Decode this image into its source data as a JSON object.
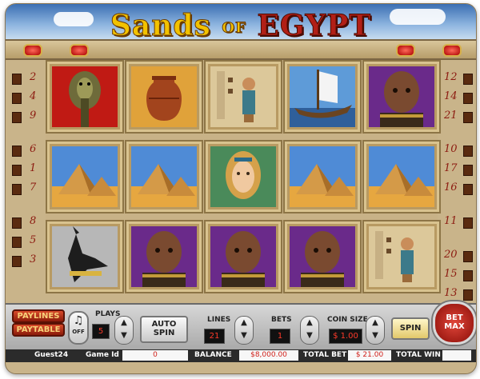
{
  "game": {
    "title_part1": "Sands",
    "title_part2": "OF",
    "title_part3": "EGYPT"
  },
  "paylines": {
    "left": [
      "2",
      "4",
      "9",
      "6",
      "1",
      "7",
      "8",
      "5",
      "3"
    ],
    "right": [
      "12",
      "14",
      "21",
      "10",
      "17",
      "16",
      "11",
      "20",
      "15",
      "13"
    ]
  },
  "reels": [
    [
      "cobra",
      "pyramids",
      "anubis"
    ],
    [
      "urn",
      "pyramids",
      "pharaoh"
    ],
    [
      "hieroglyph-goddess",
      "cleopatra",
      "pharaoh"
    ],
    [
      "ship",
      "pyramids",
      "pharaoh"
    ],
    [
      "pharaoh",
      "pyramids",
      "hieroglyph-goddess"
    ]
  ],
  "controls": {
    "paylines_label": "PAYLINES",
    "paytable_label": "PAYTABLE",
    "sound_label": "OFF",
    "plays_label": "PLAYS",
    "plays_value": "5",
    "autospin_label_1": "AUTO",
    "autospin_label_2": "SPIN",
    "lines_label": "LINES",
    "lines_value": "21",
    "bets_label": "BETS",
    "bets_value": "1",
    "coin_label": "COIN SIZE",
    "coin_value": "$ 1.00",
    "spin_label": "SPIN",
    "betmax_label_1": "BET",
    "betmax_label_2": "MAX"
  },
  "status": {
    "user": "Guest24",
    "game_id_label": "Game Id",
    "game_id_value": "0",
    "balance_label": "BALANCE",
    "balance_value": "$8,000.00",
    "total_bet_label": "TOTAL BET",
    "total_bet_value": "$ 21.00",
    "total_win_label": "TOTAL WIN",
    "total_win_value": ""
  },
  "colors": {
    "accent_red": "#b11f16",
    "gold": "#f2c200",
    "sand": "#c8b287"
  }
}
